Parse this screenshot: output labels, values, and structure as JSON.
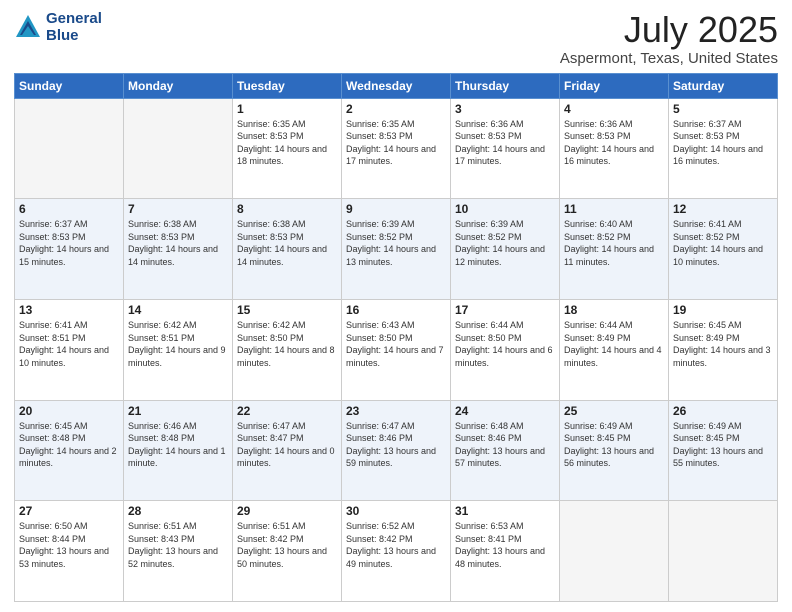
{
  "header": {
    "logo_line1": "General",
    "logo_line2": "Blue",
    "main_title": "July 2025",
    "subtitle": "Aspermont, Texas, United States"
  },
  "calendar": {
    "headers": [
      "Sunday",
      "Monday",
      "Tuesday",
      "Wednesday",
      "Thursday",
      "Friday",
      "Saturday"
    ],
    "rows": [
      [
        {
          "day": "",
          "empty": true
        },
        {
          "day": "",
          "empty": true
        },
        {
          "day": "1",
          "sunrise": "6:35 AM",
          "sunset": "8:53 PM",
          "daylight": "14 hours and 18 minutes."
        },
        {
          "day": "2",
          "sunrise": "6:35 AM",
          "sunset": "8:53 PM",
          "daylight": "14 hours and 17 minutes."
        },
        {
          "day": "3",
          "sunrise": "6:36 AM",
          "sunset": "8:53 PM",
          "daylight": "14 hours and 17 minutes."
        },
        {
          "day": "4",
          "sunrise": "6:36 AM",
          "sunset": "8:53 PM",
          "daylight": "14 hours and 16 minutes."
        },
        {
          "day": "5",
          "sunrise": "6:37 AM",
          "sunset": "8:53 PM",
          "daylight": "14 hours and 16 minutes."
        }
      ],
      [
        {
          "day": "6",
          "sunrise": "6:37 AM",
          "sunset": "8:53 PM",
          "daylight": "14 hours and 15 minutes."
        },
        {
          "day": "7",
          "sunrise": "6:38 AM",
          "sunset": "8:53 PM",
          "daylight": "14 hours and 14 minutes."
        },
        {
          "day": "8",
          "sunrise": "6:38 AM",
          "sunset": "8:53 PM",
          "daylight": "14 hours and 14 minutes."
        },
        {
          "day": "9",
          "sunrise": "6:39 AM",
          "sunset": "8:52 PM",
          "daylight": "14 hours and 13 minutes."
        },
        {
          "day": "10",
          "sunrise": "6:39 AM",
          "sunset": "8:52 PM",
          "daylight": "14 hours and 12 minutes."
        },
        {
          "day": "11",
          "sunrise": "6:40 AM",
          "sunset": "8:52 PM",
          "daylight": "14 hours and 11 minutes."
        },
        {
          "day": "12",
          "sunrise": "6:41 AM",
          "sunset": "8:52 PM",
          "daylight": "14 hours and 10 minutes."
        }
      ],
      [
        {
          "day": "13",
          "sunrise": "6:41 AM",
          "sunset": "8:51 PM",
          "daylight": "14 hours and 10 minutes."
        },
        {
          "day": "14",
          "sunrise": "6:42 AM",
          "sunset": "8:51 PM",
          "daylight": "14 hours and 9 minutes."
        },
        {
          "day": "15",
          "sunrise": "6:42 AM",
          "sunset": "8:50 PM",
          "daylight": "14 hours and 8 minutes."
        },
        {
          "day": "16",
          "sunrise": "6:43 AM",
          "sunset": "8:50 PM",
          "daylight": "14 hours and 7 minutes."
        },
        {
          "day": "17",
          "sunrise": "6:44 AM",
          "sunset": "8:50 PM",
          "daylight": "14 hours and 6 minutes."
        },
        {
          "day": "18",
          "sunrise": "6:44 AM",
          "sunset": "8:49 PM",
          "daylight": "14 hours and 4 minutes."
        },
        {
          "day": "19",
          "sunrise": "6:45 AM",
          "sunset": "8:49 PM",
          "daylight": "14 hours and 3 minutes."
        }
      ],
      [
        {
          "day": "20",
          "sunrise": "6:45 AM",
          "sunset": "8:48 PM",
          "daylight": "14 hours and 2 minutes."
        },
        {
          "day": "21",
          "sunrise": "6:46 AM",
          "sunset": "8:48 PM",
          "daylight": "14 hours and 1 minute."
        },
        {
          "day": "22",
          "sunrise": "6:47 AM",
          "sunset": "8:47 PM",
          "daylight": "14 hours and 0 minutes."
        },
        {
          "day": "23",
          "sunrise": "6:47 AM",
          "sunset": "8:46 PM",
          "daylight": "13 hours and 59 minutes."
        },
        {
          "day": "24",
          "sunrise": "6:48 AM",
          "sunset": "8:46 PM",
          "daylight": "13 hours and 57 minutes."
        },
        {
          "day": "25",
          "sunrise": "6:49 AM",
          "sunset": "8:45 PM",
          "daylight": "13 hours and 56 minutes."
        },
        {
          "day": "26",
          "sunrise": "6:49 AM",
          "sunset": "8:45 PM",
          "daylight": "13 hours and 55 minutes."
        }
      ],
      [
        {
          "day": "27",
          "sunrise": "6:50 AM",
          "sunset": "8:44 PM",
          "daylight": "13 hours and 53 minutes."
        },
        {
          "day": "28",
          "sunrise": "6:51 AM",
          "sunset": "8:43 PM",
          "daylight": "13 hours and 52 minutes."
        },
        {
          "day": "29",
          "sunrise": "6:51 AM",
          "sunset": "8:42 PM",
          "daylight": "13 hours and 50 minutes."
        },
        {
          "day": "30",
          "sunrise": "6:52 AM",
          "sunset": "8:42 PM",
          "daylight": "13 hours and 49 minutes."
        },
        {
          "day": "31",
          "sunrise": "6:53 AM",
          "sunset": "8:41 PM",
          "daylight": "13 hours and 48 minutes."
        },
        {
          "day": "",
          "empty": true
        },
        {
          "day": "",
          "empty": true
        }
      ]
    ]
  }
}
